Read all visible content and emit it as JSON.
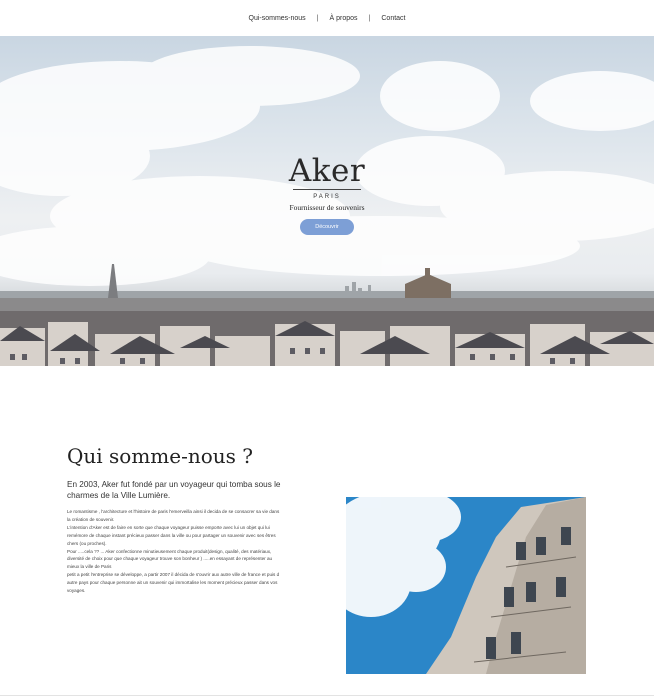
{
  "nav": {
    "items": [
      "Qui-sommes-nous",
      "À propos",
      "Contact"
    ],
    "separator": "|"
  },
  "hero": {
    "title": "Aker",
    "city": "PARIS",
    "tagline": "Fournisseur de souvenirs",
    "cta_label": "Découvrir",
    "cta_color": "#7d9fd6"
  },
  "about": {
    "title": "Qui somme-nous ?",
    "lead": "En 2003, Aker fut fondé par un voyageur qui tomba sous le charmes de la Ville Lumière.",
    "paragraphs": [
      "Le romantisme , l'architecture et l'histoire de paris l'emerveilla ainsi il decida de se consacrer sa vie dans la création de souvenir.",
      "L'intention d'Aker est de faire en sorte que chaque voyageur puisse emporte avec lui un objet qui lui remémore de chaque instant précieux passer dans la ville ou pour partager un souvenir avec ses êtres chers (ou proches).",
      "Pour .....cela ?? ... Aker confectionne minutieusement chaque produit(design, qualité, des matériaux, diversité de choix pour que chaque voyageur trouve son bonheur ) .....en essayant de représenter au mieux la ville de Paris",
      "petit a petit l'entreprise se développe, a partir 2007 il décida de s'ouvrir aux autre ville de france et puis d autre pays pour chaque personne ait un souvenir qui immortalise les moment précieux passer dans vos voyages."
    ]
  }
}
